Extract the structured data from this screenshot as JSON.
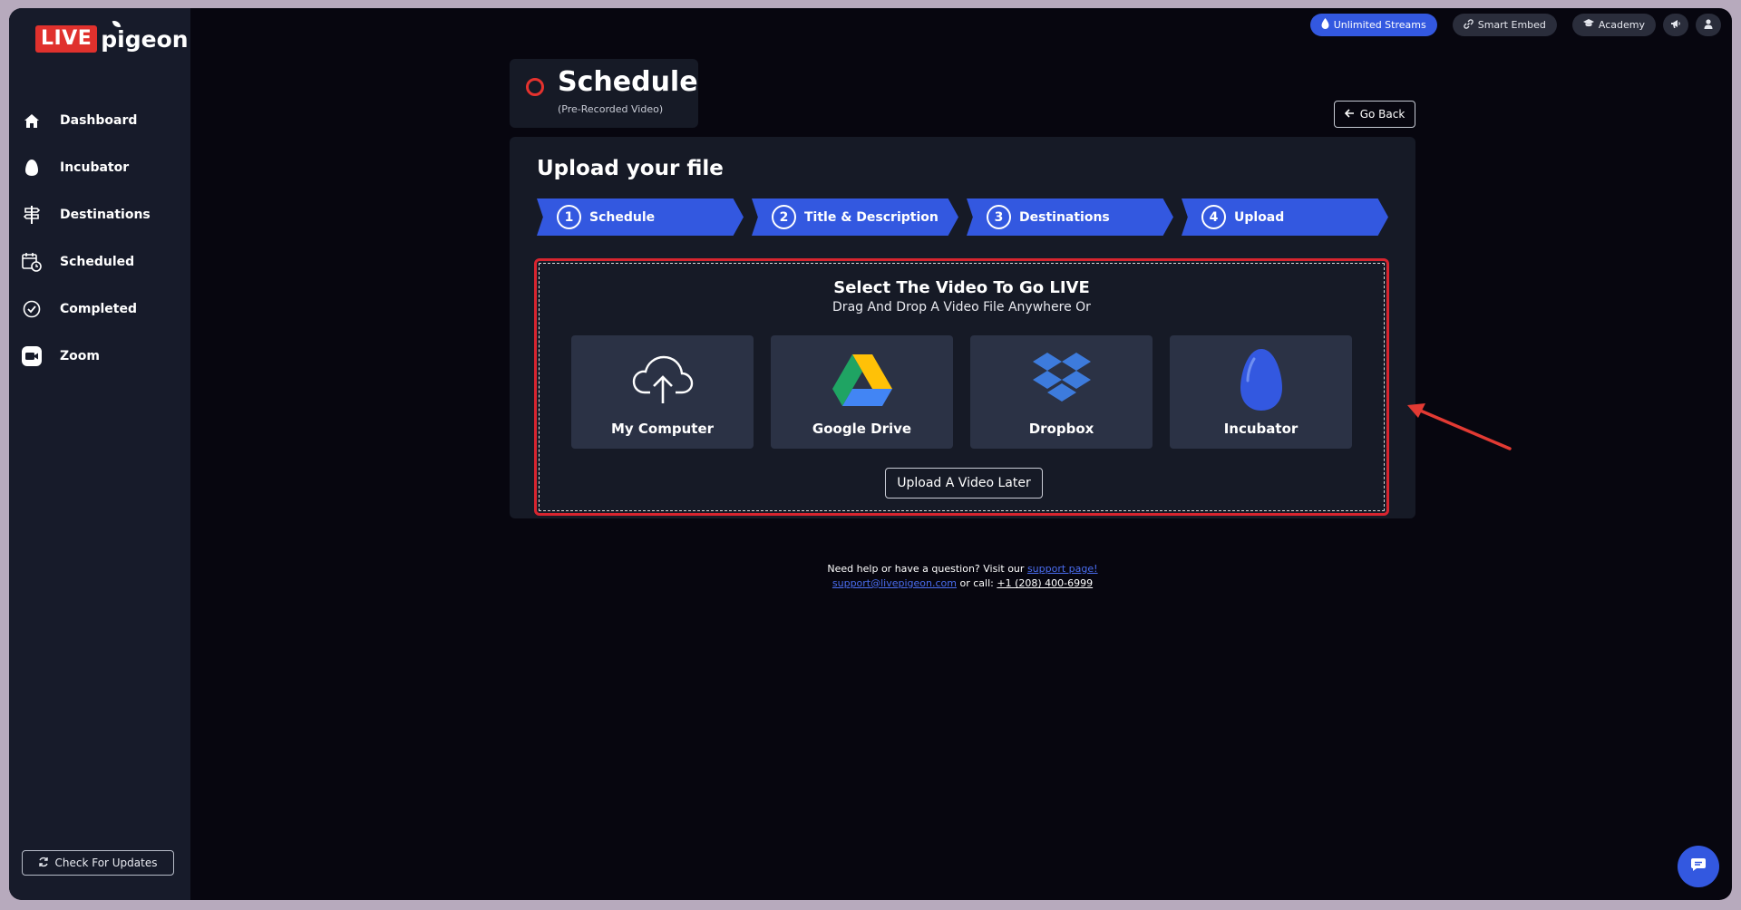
{
  "logo": {
    "live": "LIVE",
    "pigeon": "pigeon"
  },
  "sidebar": {
    "items": [
      {
        "label": "Dashboard",
        "icon": "home-icon"
      },
      {
        "label": "Incubator",
        "icon": "egg-icon"
      },
      {
        "label": "Destinations",
        "icon": "signpost-icon"
      },
      {
        "label": "Scheduled",
        "icon": "calendar-clock-icon"
      },
      {
        "label": "Completed",
        "icon": "check-circle-icon"
      },
      {
        "label": "Zoom",
        "icon": "zoom-icon"
      }
    ],
    "update_label": "Check For Updates"
  },
  "topbar": {
    "unlimited": "Unlimited Streams",
    "smart_embed": "Smart Embed",
    "academy": "Academy"
  },
  "header": {
    "title": "Schedule",
    "subtitle": "(Pre-Recorded Video)",
    "go_back": "Go Back"
  },
  "upload": {
    "title": "Upload your file",
    "steps": [
      {
        "num": "1",
        "label": "Schedule"
      },
      {
        "num": "2",
        "label": "Title & Description"
      },
      {
        "num": "3",
        "label": "Destinations"
      },
      {
        "num": "4",
        "label": "Upload"
      }
    ],
    "drop_title": "Select The Video To Go LIVE",
    "drop_sub": "Drag And Drop A Video File Anywhere Or",
    "sources": [
      {
        "label": "My Computer",
        "icon": "cloud-upload-icon"
      },
      {
        "label": "Google Drive",
        "icon": "google-drive-icon"
      },
      {
        "label": "Dropbox",
        "icon": "dropbox-icon"
      },
      {
        "label": "Incubator",
        "icon": "egg-icon"
      }
    ],
    "later": "Upload A Video Later"
  },
  "help": {
    "prefix": "Need help or have a question? Visit our",
    "support_link": "support page!",
    "email": "support@livepigeon.com",
    "or_call": "or call:",
    "phone": "+1 (208) 400-6999"
  },
  "colors": {
    "accent": "#3358e0",
    "record": "#e5322e",
    "highlight": "#d8252f",
    "sidebar": "#171b2a",
    "background": "#07060f"
  }
}
